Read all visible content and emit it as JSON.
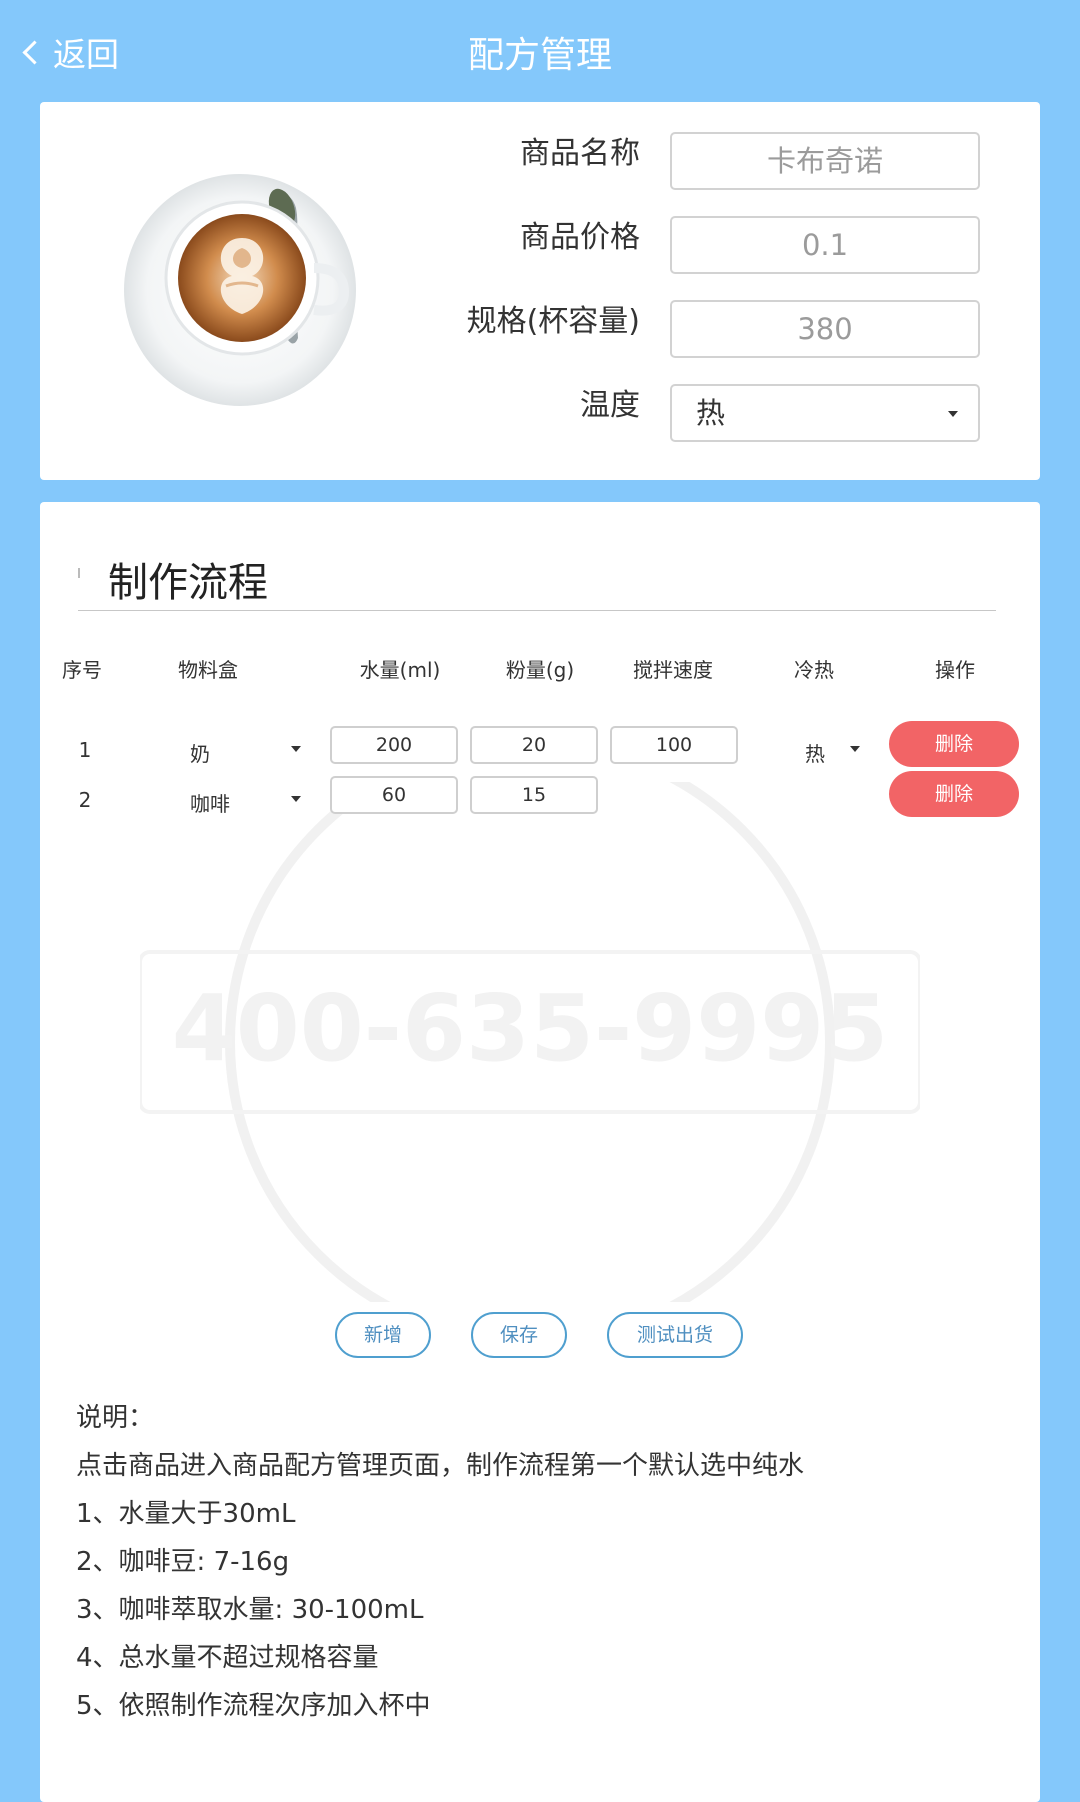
{
  "header": {
    "back_label": "返回",
    "title": "配方管理"
  },
  "product": {
    "name_label": "商品名称",
    "name_placeholder": "卡布奇诺",
    "price_label": "商品价格",
    "price_placeholder": "0.1",
    "spec_label": "规格(杯容量)",
    "spec_placeholder": "380",
    "temp_label": "温度",
    "temp_value": "热"
  },
  "process": {
    "title": "制作流程",
    "columns": [
      "序号",
      "物料盒",
      "水量(ml)",
      "粉量(g)",
      "搅拌速度",
      "冷热",
      "操作"
    ],
    "rows": [
      {
        "index": "1",
        "material": "奶",
        "water": "200",
        "powder": "20",
        "speed": "100",
        "temp": "热",
        "action": "删除"
      },
      {
        "index": "2",
        "material": "咖啡",
        "water": "60",
        "powder": "15",
        "speed": "",
        "temp": "",
        "action": "删除"
      }
    ],
    "buttons": {
      "add": "新增",
      "save": "保存",
      "test": "测试出货"
    }
  },
  "notes": {
    "title": "说明：",
    "lines": [
      "点击商品进入商品配方管理页面，制作流程第一个默认选中纯水",
      "1、水量大于30mL",
      "2、咖啡豆: 7-16g",
      "3、咖啡萃取水量: 30-100mL",
      "4、总水量不超过规格容量",
      "5、依照制作流程次序加入杯中"
    ]
  },
  "watermark": {
    "phone": "400-635-9995"
  },
  "colors": {
    "background": "#84c8fb",
    "delete_button": "#f26466",
    "action_border": "#4f9fcf"
  }
}
